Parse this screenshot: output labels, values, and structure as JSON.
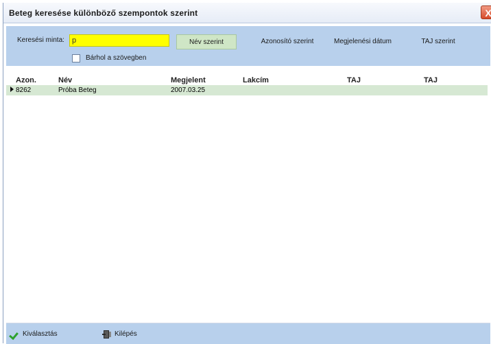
{
  "window": {
    "title": "Beteg keresése különböző szempontok szerint",
    "close_label": "X"
  },
  "search": {
    "label": "Keresési minta:",
    "value": "p",
    "anywhere_label": "Bárhol a szövegben",
    "anywhere_checked": false,
    "buttons": {
      "by_name": "Név szerint",
      "by_id": "Azonosító szerint",
      "by_date": "Megjelenési dátum",
      "by_taj": "TAJ szerint"
    }
  },
  "grid": {
    "columns": {
      "id": "Azon.",
      "name": "Név",
      "appeared": "Megjelent",
      "address": "Lakcím",
      "taj1": "TAJ",
      "taj2": "TAJ"
    },
    "rows": [
      {
        "id": "8262",
        "name": "Próba Beteg",
        "appeared": "2007.03.25",
        "address": "",
        "taj1": "",
        "taj2": ""
      }
    ]
  },
  "statusbar": {
    "select_label": "Kiválasztás",
    "exit_label": "Kilépés"
  },
  "colors": {
    "panel": "#b8d0ec",
    "search_highlight": "#ffff00",
    "selected_row": "#d6e8d3",
    "active_button": "#cfe6c6",
    "close_button": "#d64a2a"
  }
}
